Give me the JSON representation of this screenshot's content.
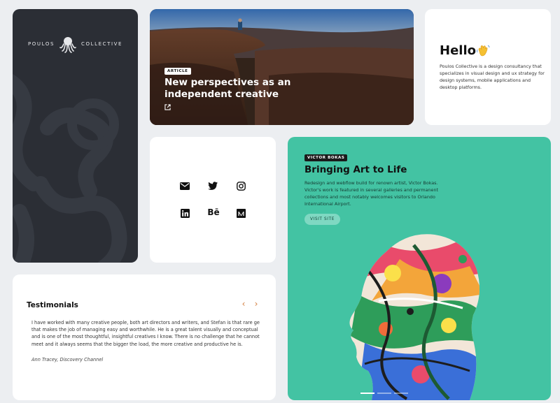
{
  "brand": {
    "name_left": "POULOS",
    "name_right": "COLLECTIVE",
    "logo_icon": "octopus-icon"
  },
  "article": {
    "tag": "ARTICLE",
    "title": "New perspectives as an independent creative",
    "link_icon": "external-link-icon"
  },
  "hello": {
    "title": "Hello",
    "emoji_icon": "waving-hand-icon",
    "text": "Poulos Collective is a design consultancy that specializes in visual design and ux strategy for design systems, mobile applications and desktop platforms."
  },
  "social": {
    "items": [
      "mail-icon",
      "twitter-icon",
      "instagram-icon",
      "linkedin-icon",
      "behance-icon",
      "medium-icon"
    ]
  },
  "victor": {
    "tag": "VICTOR BOKAS",
    "title": "Bringing Art to Life",
    "text": "Redesign and webflow build for renown artist, Victor Bokas. Victor's work is featured in several galleries and permanent collections and most notably welcomes visitors to Orlando International Airport.",
    "button": "VISIT SITE",
    "accent": "#43c3a3"
  },
  "testimonials": {
    "title": "Testimonials",
    "quote": "I have worked with many creative people, both art directors and writers, and Stefan is that rare ge that makes the job of managing easy and worthwhile. He is a great talent visually and conceptual and is one of the most thoughtful, insightful creatives I know. There is no challenge that he cannot meet and it always seems that the bigger the load, the more creative and productive he is.",
    "author": "Ann Tracey, Discovery Channel",
    "prev_icon": "chevron-left-icon",
    "next_icon": "chevron-right-icon",
    "accent": "#d27b3a"
  }
}
